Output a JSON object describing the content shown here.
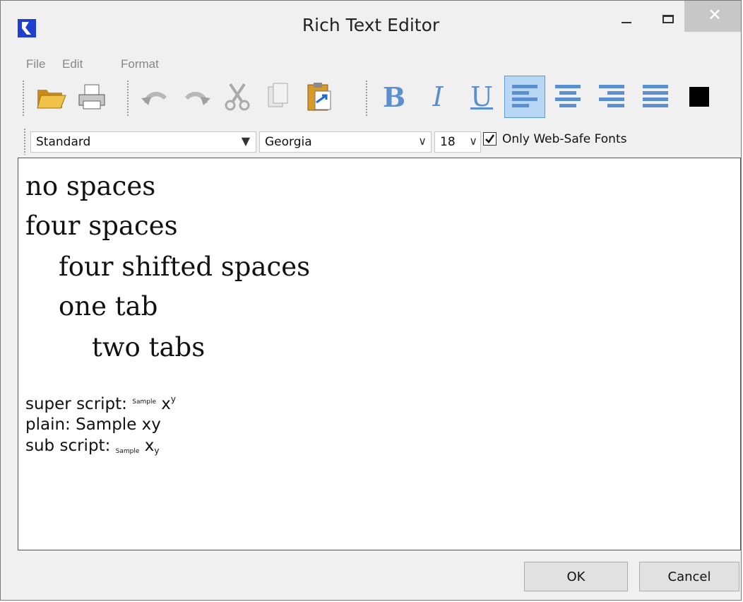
{
  "window": {
    "title": "Rich Text Editor"
  },
  "window_controls": {
    "close_glyph": "✕"
  },
  "menu": [
    "File",
    "Edit",
    "Format"
  ],
  "toolbar": {
    "icons": [
      "open-folder-icon",
      "print-icon",
      "undo-icon",
      "redo-icon",
      "cut-icon",
      "copy-icon",
      "paste-icon",
      "bold-icon",
      "italic-icon",
      "underline-icon",
      "align-left-icon",
      "align-center-icon",
      "align-right-icon",
      "align-justify-icon",
      "text-color-icon"
    ],
    "bold_glyph": "B",
    "italic_glyph": "I",
    "underline_glyph": "U",
    "text_color": "#000000"
  },
  "format": {
    "style_value": "Standard",
    "font_value": "Georgia",
    "size_value": "18",
    "web_safe_label": "Only Web-Safe Fonts",
    "web_safe_checked": true
  },
  "editor": {
    "lines": [
      "no spaces",
      "four spaces",
      "four shifted spaces",
      "one tab",
      "two tabs"
    ],
    "superscript_label": "super script:",
    "superscript_sample": "Sample",
    "superscript_x": "x",
    "superscript_y": "y",
    "plain_line": "plain: Sample xy",
    "subscript_label": "sub script:",
    "subscript_sample": "Sample",
    "subscript_x": "x",
    "subscript_y": "y"
  },
  "buttons": {
    "ok": "OK",
    "cancel": "Cancel"
  },
  "colors": {
    "active_tool": "#b8d7f4",
    "logo_blue": "#1f3fd1"
  }
}
